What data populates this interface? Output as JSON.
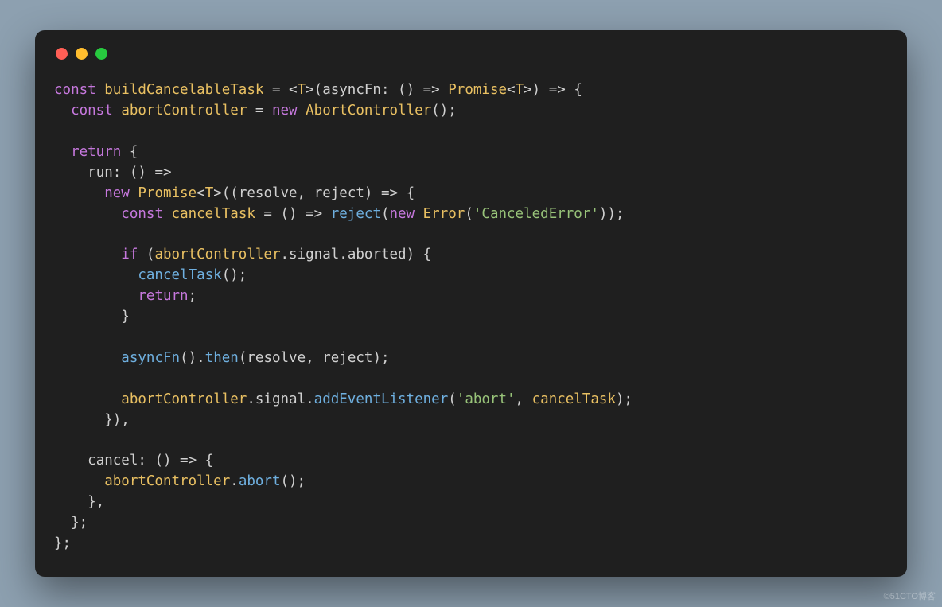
{
  "window": {
    "traffic_lights": {
      "red": "#ff5f56",
      "yellow": "#ffbd2e",
      "green": "#27c93f"
    }
  },
  "code": {
    "language": "typescript",
    "tokens": [
      [
        [
          "key",
          "const"
        ],
        [
          "p",
          " "
        ],
        [
          "ident",
          "buildCancelableTask"
        ],
        [
          "p",
          " = <"
        ],
        [
          "type",
          "T"
        ],
        [
          "p",
          ">("
        ],
        [
          "param",
          "asyncFn"
        ],
        [
          "p",
          ": () => "
        ],
        [
          "type",
          "Promise"
        ],
        [
          "p",
          "<"
        ],
        [
          "type",
          "T"
        ],
        [
          "p",
          ">) => {"
        ]
      ],
      [
        [
          "p",
          "  "
        ],
        [
          "key",
          "const"
        ],
        [
          "p",
          " "
        ],
        [
          "ident",
          "abortController"
        ],
        [
          "p",
          " = "
        ],
        [
          "key",
          "new"
        ],
        [
          "p",
          " "
        ],
        [
          "type",
          "AbortController"
        ],
        [
          "p",
          "();"
        ]
      ],
      [],
      [
        [
          "p",
          "  "
        ],
        [
          "key",
          "return"
        ],
        [
          "p",
          " {"
        ]
      ],
      [
        [
          "p",
          "    "
        ],
        [
          "prop",
          "run"
        ],
        [
          "p",
          ": () =>"
        ]
      ],
      [
        [
          "p",
          "      "
        ],
        [
          "key",
          "new"
        ],
        [
          "p",
          " "
        ],
        [
          "type",
          "Promise"
        ],
        [
          "p",
          "<"
        ],
        [
          "type",
          "T"
        ],
        [
          "p",
          ">(("
        ],
        [
          "param",
          "resolve"
        ],
        [
          "p",
          ", "
        ],
        [
          "param",
          "reject"
        ],
        [
          "p",
          ") => {"
        ]
      ],
      [
        [
          "p",
          "        "
        ],
        [
          "key",
          "const"
        ],
        [
          "p",
          " "
        ],
        [
          "ident",
          "cancelTask"
        ],
        [
          "p",
          " = () => "
        ],
        [
          "func",
          "reject"
        ],
        [
          "p",
          "("
        ],
        [
          "key",
          "new"
        ],
        [
          "p",
          " "
        ],
        [
          "type",
          "Error"
        ],
        [
          "p",
          "("
        ],
        [
          "str",
          "'CanceledError'"
        ],
        [
          "p",
          "));"
        ]
      ],
      [],
      [
        [
          "p",
          "        "
        ],
        [
          "key",
          "if"
        ],
        [
          "p",
          " ("
        ],
        [
          "ident",
          "abortController"
        ],
        [
          "p",
          "."
        ],
        [
          "prop",
          "signal"
        ],
        [
          "p",
          "."
        ],
        [
          "prop",
          "aborted"
        ],
        [
          "p",
          ") {"
        ]
      ],
      [
        [
          "p",
          "          "
        ],
        [
          "func",
          "cancelTask"
        ],
        [
          "p",
          "();"
        ]
      ],
      [
        [
          "p",
          "          "
        ],
        [
          "key",
          "return"
        ],
        [
          "p",
          ";"
        ]
      ],
      [
        [
          "p",
          "        }"
        ]
      ],
      [],
      [
        [
          "p",
          "        "
        ],
        [
          "func",
          "asyncFn"
        ],
        [
          "p",
          "()."
        ],
        [
          "func",
          "then"
        ],
        [
          "p",
          "("
        ],
        [
          "param",
          "resolve"
        ],
        [
          "p",
          ", "
        ],
        [
          "param",
          "reject"
        ],
        [
          "p",
          ");"
        ]
      ],
      [],
      [
        [
          "p",
          "        "
        ],
        [
          "ident",
          "abortController"
        ],
        [
          "p",
          "."
        ],
        [
          "prop",
          "signal"
        ],
        [
          "p",
          "."
        ],
        [
          "func",
          "addEventListener"
        ],
        [
          "p",
          "("
        ],
        [
          "str",
          "'abort'"
        ],
        [
          "p",
          ", "
        ],
        [
          "ident",
          "cancelTask"
        ],
        [
          "p",
          ");"
        ]
      ],
      [
        [
          "p",
          "      }),"
        ]
      ],
      [],
      [
        [
          "p",
          "    "
        ],
        [
          "prop",
          "cancel"
        ],
        [
          "p",
          ": () => {"
        ]
      ],
      [
        [
          "p",
          "      "
        ],
        [
          "ident",
          "abortController"
        ],
        [
          "p",
          "."
        ],
        [
          "func",
          "abort"
        ],
        [
          "p",
          "();"
        ]
      ],
      [
        [
          "p",
          "    },"
        ]
      ],
      [
        [
          "p",
          "  };"
        ]
      ],
      [
        [
          "p",
          "};"
        ]
      ]
    ]
  },
  "watermark": "©51CTO博客"
}
